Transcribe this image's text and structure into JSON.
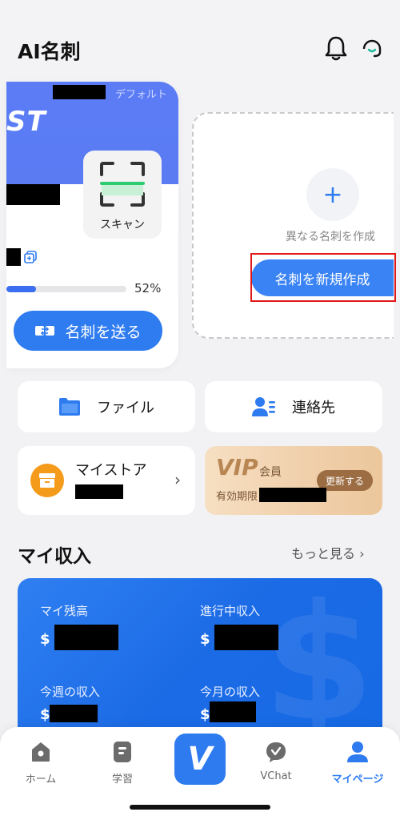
{
  "header": {
    "title": "AI名刺",
    "bell_icon": "bell-icon",
    "support_icon": "support-icon"
  },
  "card": {
    "default_tag": "デフォルト",
    "logo_text": "ST",
    "scan_label": "スキャン",
    "progress_percent": 52,
    "progress_text": "52%",
    "send_label": "名刺を送る"
  },
  "new_card": {
    "plus": "+",
    "different_card_text": "異なる名刺を作成",
    "create_button": "名刺を新規作成"
  },
  "tiles": {
    "file": "ファイル",
    "contacts": "連絡先",
    "store": "マイストア",
    "vip": "VIP",
    "vip_member": "会員",
    "vip_renew": "更新する",
    "vip_expiry": "有効期限"
  },
  "income": {
    "title": "マイ収入",
    "more": "もっと見る ›",
    "balance_label": "マイ残高",
    "in_progress_label": "進行中収入",
    "week_label": "今週の収入",
    "month_label": "今月の収入",
    "currency": "$"
  },
  "tabbar": {
    "home": "ホーム",
    "learn": "学習",
    "center": "V",
    "vchat": "VChat",
    "mypage": "マイページ"
  },
  "colors": {
    "accent": "#2e7bf0",
    "card_blue": "#5b7cf5",
    "store_orange": "#f59b1c",
    "vip_gold": "#b88653",
    "highlight_red": "#e01818"
  }
}
